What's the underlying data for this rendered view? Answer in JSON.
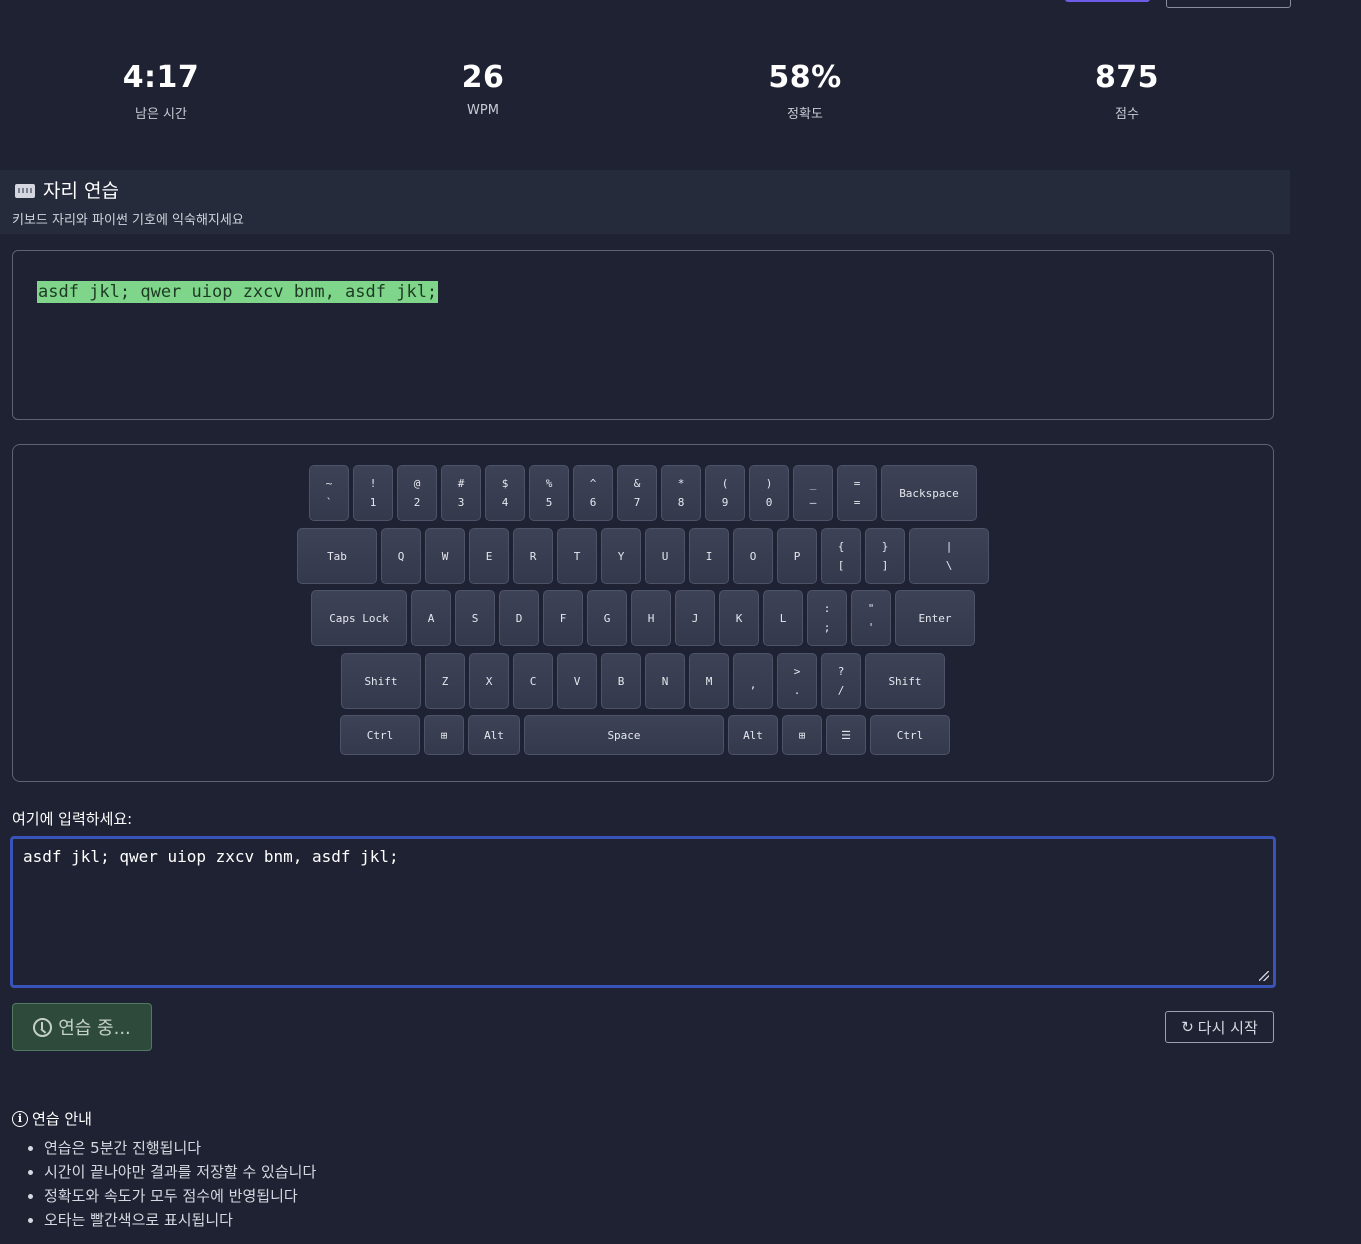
{
  "stats": [
    {
      "value": "4:17",
      "label": "남은 시간"
    },
    {
      "value": "26",
      "label": "WPM"
    },
    {
      "value": "58%",
      "label": "정확도"
    },
    {
      "value": "875",
      "label": "점수"
    }
  ],
  "section": {
    "icon": "keyboard-icon",
    "title": "자리 연습",
    "subtitle": "키보드 자리와 파이썬 기호에 익숙해지세요"
  },
  "target_text": "asdf jkl; qwer uiop zxcv bnm, asdf jkl;",
  "keyboard": {
    "row1": [
      [
        "~",
        "`"
      ],
      [
        "!",
        "1"
      ],
      [
        "@",
        "2"
      ],
      [
        "#",
        "3"
      ],
      [
        "$",
        "4"
      ],
      [
        "%",
        "5"
      ],
      [
        "^",
        "6"
      ],
      [
        "&",
        "7"
      ],
      [
        "*",
        "8"
      ],
      [
        "(",
        "9"
      ],
      [
        ")",
        "0"
      ],
      [
        "_",
        "–"
      ],
      [
        "=",
        "="
      ],
      [
        "Backspace",
        ""
      ]
    ],
    "row2": [
      [
        "Tab",
        ""
      ],
      [
        "Q",
        ""
      ],
      [
        "W",
        ""
      ],
      [
        "E",
        ""
      ],
      [
        "R",
        ""
      ],
      [
        "T",
        ""
      ],
      [
        "Y",
        ""
      ],
      [
        "U",
        ""
      ],
      [
        "I",
        ""
      ],
      [
        "O",
        ""
      ],
      [
        "P",
        ""
      ],
      [
        "{",
        "["
      ],
      [
        "}",
        "]"
      ],
      [
        "|",
        "\\"
      ]
    ],
    "row3": [
      [
        "Caps Lock",
        ""
      ],
      [
        "A",
        ""
      ],
      [
        "S",
        ""
      ],
      [
        "D",
        ""
      ],
      [
        "F",
        ""
      ],
      [
        "G",
        ""
      ],
      [
        "H",
        ""
      ],
      [
        "J",
        ""
      ],
      [
        "K",
        ""
      ],
      [
        "L",
        ""
      ],
      [
        ":",
        ";"
      ],
      [
        "\"",
        "'"
      ],
      [
        "Enter",
        ""
      ]
    ],
    "row4": [
      [
        "Shift",
        ""
      ],
      [
        "Z",
        ""
      ],
      [
        "X",
        ""
      ],
      [
        "C",
        ""
      ],
      [
        "V",
        ""
      ],
      [
        "B",
        ""
      ],
      [
        "N",
        ""
      ],
      [
        "M",
        ""
      ],
      [
        "",
        ","
      ],
      [
        ">",
        "."
      ],
      [
        "?",
        "/"
      ],
      [
        "Shift",
        ""
      ]
    ],
    "row5": [
      [
        "Ctrl",
        ""
      ],
      [
        "⊞",
        ""
      ],
      [
        "Alt",
        ""
      ],
      [
        "Space",
        ""
      ],
      [
        "Alt",
        ""
      ],
      [
        "⊞",
        ""
      ],
      [
        "☰",
        ""
      ],
      [
        "Ctrl",
        ""
      ]
    ]
  },
  "input": {
    "label": "여기에 입력하세요:",
    "value": "asdf jkl; qwer uiop zxcv bnm, asdf jkl;"
  },
  "buttons": {
    "practicing_label": "연습 중...",
    "restart_label": "다시 시작"
  },
  "guide": {
    "title": "연습 안내",
    "items": [
      "연습은 5분간 진행됩니다",
      "시간이 끝나야만 결과를 저장할 수 있습니다",
      "정확도와 속도가 모두 점수에 반영됩니다",
      "오타는 빨간색으로 표시됩니다"
    ]
  },
  "colors": {
    "background": "#1e2232",
    "correct_highlight": "#7fd68b",
    "input_focus": "#3a53b8",
    "practicing_button": "#2e4a3b"
  }
}
